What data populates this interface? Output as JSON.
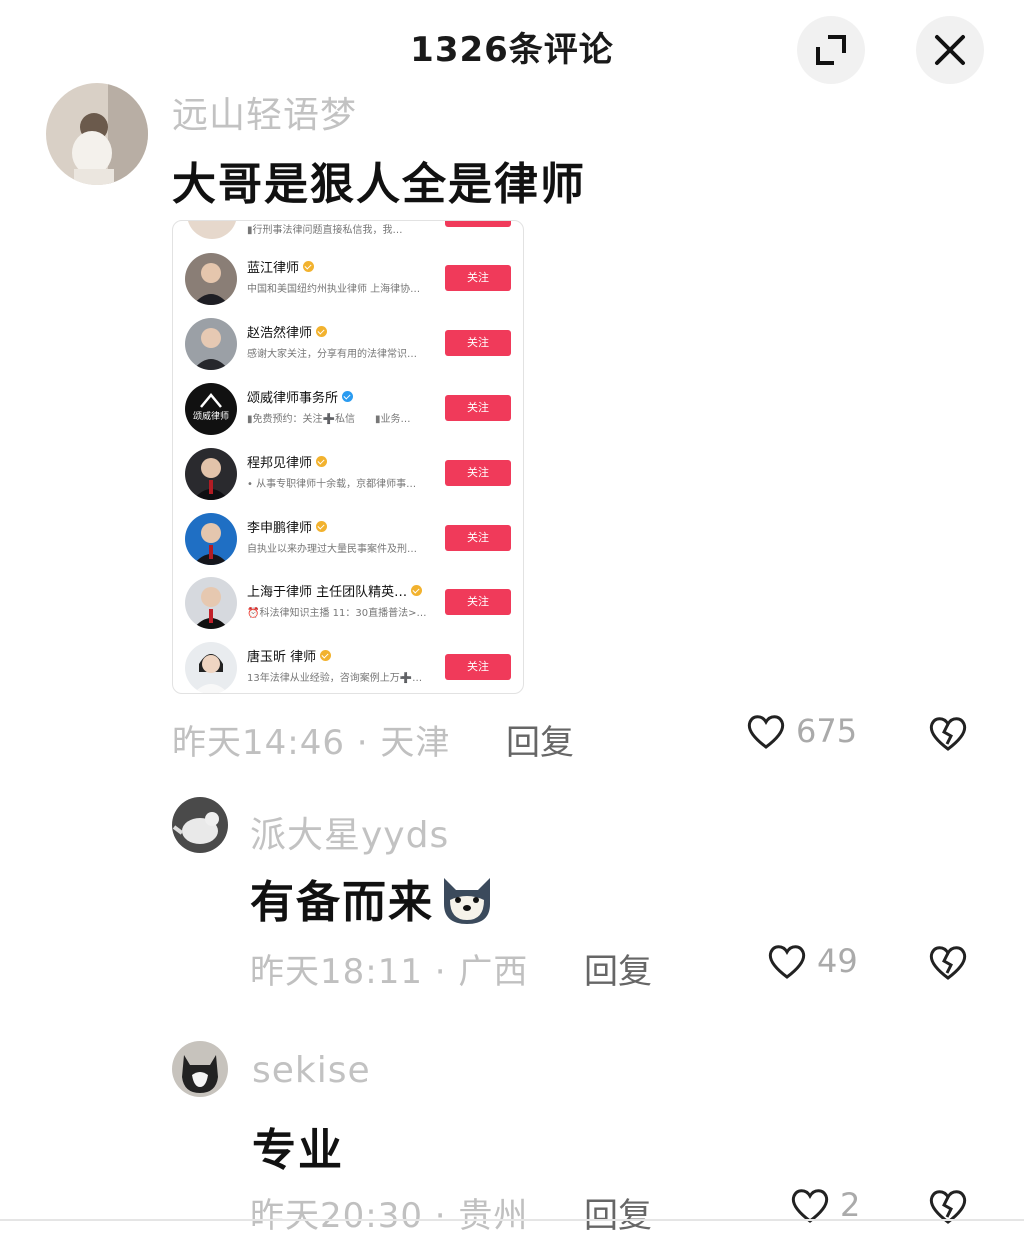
{
  "header": {
    "title": "1326条评论"
  },
  "comments": [
    {
      "username": "远山轻语梦",
      "text": "大哥是狠人全是律师",
      "meta": "昨天14:46 · 天津",
      "reply": "回复",
      "likes": "675"
    },
    {
      "username": "派大星yyds",
      "text": "有备而来",
      "meta": "昨天18:11 · 广西",
      "reply": "回复",
      "likes": "49"
    },
    {
      "username": "sekise",
      "text": "专业",
      "meta": "昨天20:30 · 贵州",
      "reply": "回复",
      "likes": "2"
    }
  ],
  "embed": {
    "top_text": "▮行刑事法律问题直接私信我，我…",
    "follow_label": "关注",
    "lawyers": [
      {
        "name": "蓝江律师",
        "desc": "中国和美国纽约州执业律师 上海律协…",
        "badge": "gold"
      },
      {
        "name": "赵浩然律师",
        "desc": "感谢大家关注，分享有用的法律常识…",
        "badge": "gold"
      },
      {
        "name": "颂威律师事务所",
        "desc": "▮免费预约：关注➕私信　　▮业务…",
        "badge": "blue",
        "logo_text": "颂威律师"
      },
      {
        "name": "程邦见律师",
        "desc": "• 从事专职律师十余载，京都律师事…",
        "badge": "gold"
      },
      {
        "name": "李申鹏律师",
        "desc": "自执业以来办理过大量民事案件及刑…",
        "badge": "gold"
      },
      {
        "name": "上海于律师 主任团队精英…",
        "desc": "⏰科法律知识主播 11：30直播普法>…",
        "badge": "gold"
      },
      {
        "name": "唐玉昕 律师",
        "desc": "13年法律从业经验，咨询案例上万➕…",
        "badge": "gold"
      }
    ]
  },
  "colors": {
    "follow": "#f03a5a",
    "muted": "#c0c0c0"
  }
}
